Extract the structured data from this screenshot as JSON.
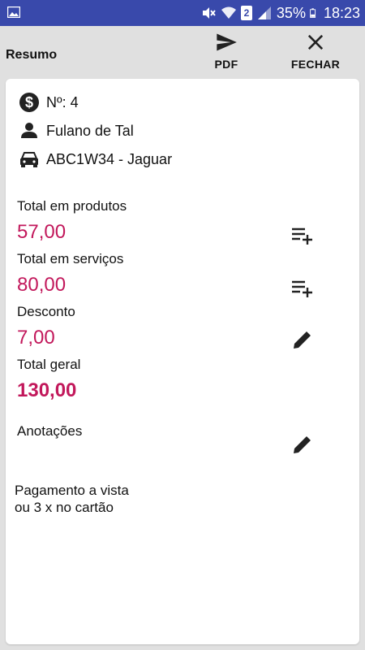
{
  "statusbar": {
    "battery_percent": "35%",
    "time": "18:23",
    "sim_slot": "2",
    "background_color": "#3949ab"
  },
  "toolbar": {
    "title": "Resumo",
    "pdf_label": "PDF",
    "close_label": "FECHAR"
  },
  "summary": {
    "number": "Nº: 4",
    "client": "Fulano de Tal",
    "vehicle": "ABC1W34 - Jaguar"
  },
  "totals": {
    "products_label": "Total em produtos",
    "products_value": "57,00",
    "services_label": "Total em serviços",
    "services_value": "80,00",
    "discount_label": "Desconto",
    "discount_value": "7,00",
    "grand_label": "Total geral",
    "grand_value": "130,00"
  },
  "notes": {
    "label": "Anotações",
    "text": "Pagamento a vista\nou 3 x no cartão"
  },
  "colors": {
    "accent": "#c2185b"
  },
  "icons": {
    "number": "dollar-circle-icon",
    "client": "person-icon",
    "vehicle": "car-icon",
    "pdf": "send-icon",
    "close": "close-icon",
    "add_products": "playlist-add-icon",
    "add_services": "playlist-add-icon",
    "edit_discount": "pencil-icon",
    "edit_notes": "pencil-icon"
  }
}
